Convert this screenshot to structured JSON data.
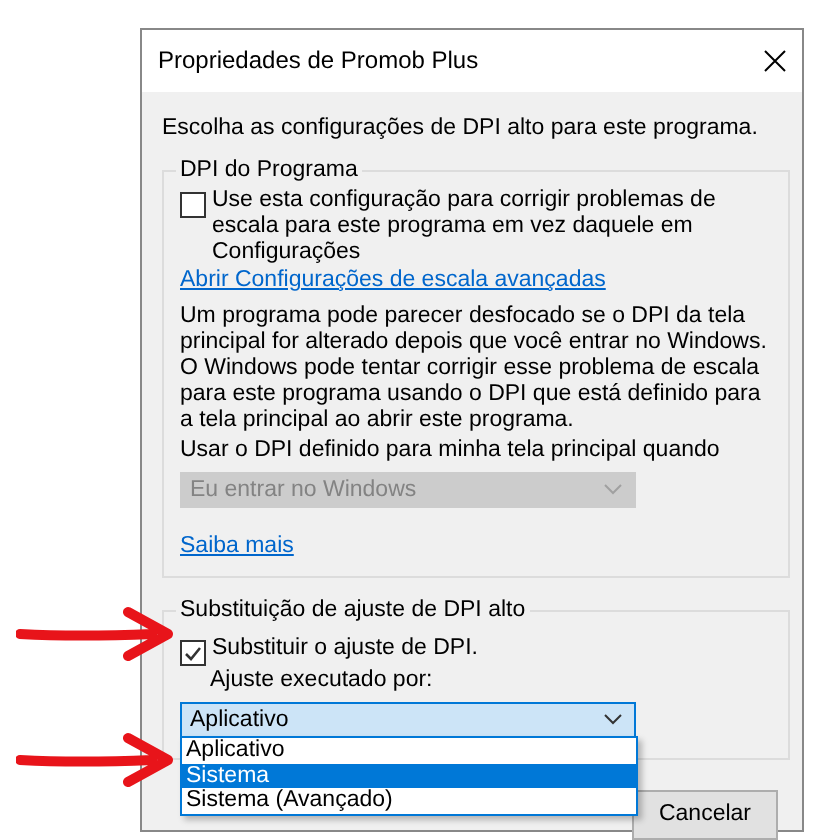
{
  "window": {
    "title": "Propriedades de Promob Plus"
  },
  "intro": "Escolha as configurações de DPI alto para este programa.",
  "program_dpi": {
    "title": "DPI do Programa",
    "checkbox": {
      "label": "Use esta configuração para corrigir problemas de escala para este programa em vez daquele em Configurações",
      "checked": false
    },
    "advanced_link": "Abrir Configurações de escala avançadas",
    "description": "Um programa pode parecer desfocado se o DPI da tela principal for alterado depois que você entrar no Windows. O Windows pode tentar corrigir esse problema de escala para este programa usando o DPI que está definido para a tela principal ao abrir este programa.",
    "prompt": "Usar o DPI definido para minha tela principal quando",
    "dropdown": {
      "value": "Eu entrar no Windows",
      "disabled": true
    },
    "learn_more_link": "Saiba mais"
  },
  "override": {
    "title": "Substituição de ajuste de DPI alto",
    "checkbox": {
      "label": "Substituir o ajuste de DPI.",
      "checked": true
    },
    "sublabel": "Ajuste executado por:",
    "dropdown": {
      "value": "Aplicativo",
      "expanded": true,
      "options": [
        {
          "label": "Aplicativo",
          "highlighted": false
        },
        {
          "label": "Sistema",
          "highlighted": true
        },
        {
          "label": "Sistema (Avançado)",
          "highlighted": false
        }
      ]
    }
  },
  "buttons": [
    {
      "label": "Cancelar"
    }
  ]
}
